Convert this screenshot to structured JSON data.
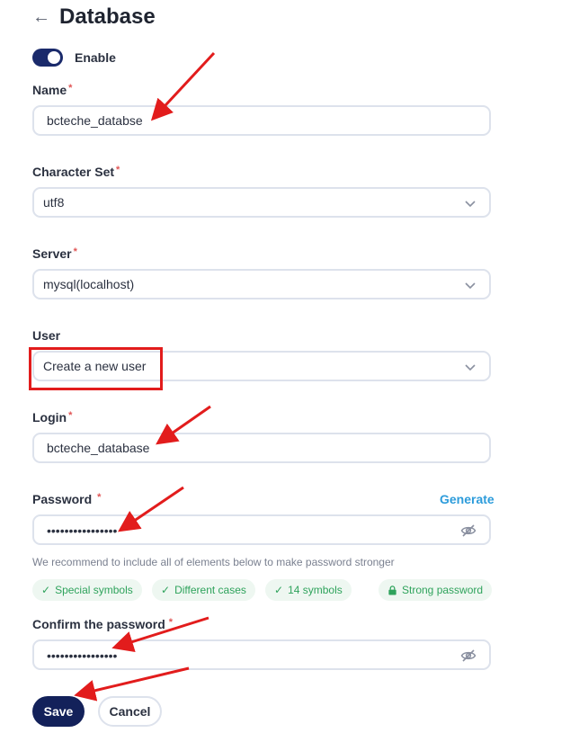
{
  "header": {
    "back_icon": "←",
    "title": "Database"
  },
  "enable": {
    "label": "Enable",
    "on": true
  },
  "fields": {
    "name": {
      "label": "Name",
      "required": "*",
      "value": "bcteche_databse"
    },
    "charset": {
      "label": "Character Set",
      "required": "*",
      "value": "utf8"
    },
    "server": {
      "label": "Server",
      "required": "*",
      "value": "mysql(localhost)"
    },
    "user": {
      "label": "User",
      "value": "Create a new user"
    },
    "login": {
      "label": "Login",
      "required": "*",
      "value": "bcteche_database"
    },
    "password": {
      "label": "Password",
      "required": "*",
      "value": "••••••••••••••••",
      "generate": "Generate"
    },
    "confirm": {
      "label": "Confirm the password",
      "required": "*",
      "value": "••••••••••••••••"
    }
  },
  "hint": "We recommend to include all of elements below to make password stronger",
  "chips": {
    "special": {
      "check": "✓",
      "label": "Special symbols"
    },
    "cases": {
      "check": "✓",
      "label": "Different cases"
    },
    "length": {
      "check": "✓",
      "label": "14 symbols"
    },
    "strong": {
      "icon": "lock-icon",
      "label": "Strong password"
    }
  },
  "buttons": {
    "save": "Save",
    "cancel": "Cancel"
  },
  "colors": {
    "primary": "#13215a",
    "accent": "#2d9cdb",
    "success": "#2fa35c",
    "required": "#e05555",
    "annotation": "#e21c1c"
  }
}
